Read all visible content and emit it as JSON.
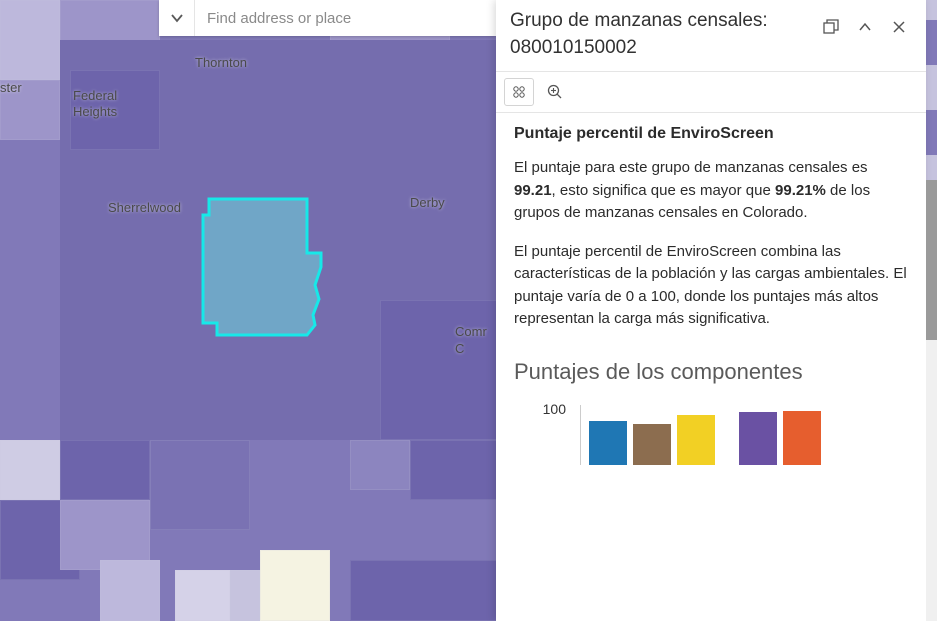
{
  "search": {
    "placeholder": "Find address or place"
  },
  "map": {
    "labels": {
      "thornton": "Thornton",
      "federal_heights": "Federal\nHeights",
      "sherrelwood": "Sherrelwood",
      "derby": "Derby",
      "commerce": "Comr\nC",
      "ster": "ster"
    }
  },
  "popup": {
    "title_prefix": "Grupo de manzanas censales:",
    "title_id": "080010150002",
    "heading": "Puntaje percentil de EnviroScreen",
    "para1_a": "El puntaje para este grupo de manzanas censales es ",
    "score": "99.21",
    "para1_b": ", esto significa que es mayor que ",
    "percent": "99.21%",
    "para1_c": "  de los grupos de manzanas censales en Colorado.",
    "para2": "El puntaje percentil de EnviroScreen combina las características de la población y las cargas ambientales. El puntaje varía de 0 a 100, donde los puntajes más altos representan la carga más significativa.",
    "subtitle": "Puntajes de los componentes"
  },
  "chart_data": {
    "type": "bar",
    "ylim": [
      0,
      100
    ],
    "y_tick_visible": 100,
    "series": [
      {
        "value": 78,
        "color": "#1f77b4"
      },
      {
        "value": 72,
        "color": "#8c6d4f"
      },
      {
        "value": 88,
        "color": "#f2d024"
      },
      {
        "value": 95,
        "color": "#6a51a3"
      },
      {
        "value": 96,
        "color": "#e65e2e"
      }
    ]
  }
}
